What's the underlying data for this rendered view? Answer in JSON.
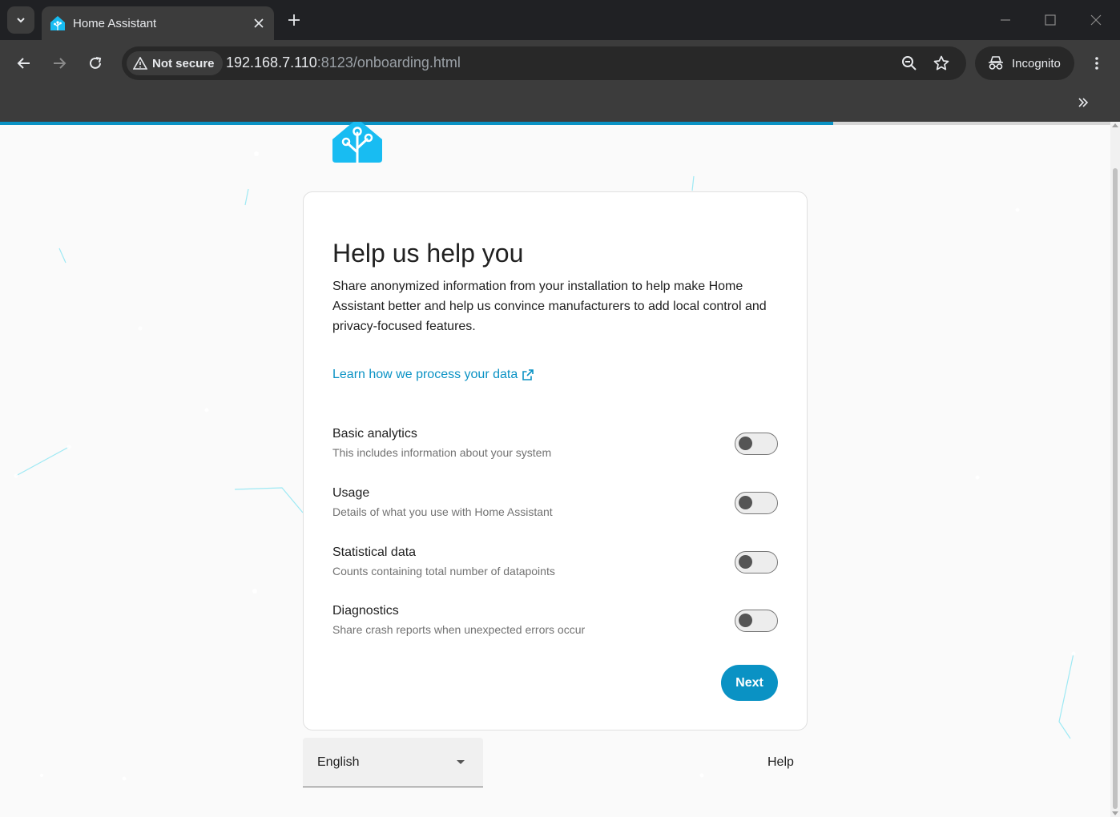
{
  "browser": {
    "tab_title": "Home Assistant",
    "security_label": "Not secure",
    "url_host": "192.168.7.110",
    "url_rest": ":8123/onboarding.html",
    "incognito_label": "Incognito",
    "icons": {
      "tab_search": "chevron-down-icon",
      "tab_close": "close-icon",
      "new_tab": "plus-icon",
      "back": "arrow-left-icon",
      "forward": "arrow-right-icon",
      "reload": "reload-icon",
      "security": "warning-icon",
      "zoom": "zoom-icon",
      "bookmark": "star-icon",
      "incognito": "incognito-icon",
      "menu": "kebab-menu-icon",
      "overflow": "double-chevron-icon"
    }
  },
  "page": {
    "progress_fraction": 0.75,
    "accent_color": "#0a92c4",
    "card": {
      "title": "Help us help you",
      "description": "Share anonymized information from your installation to help make Home Assistant better and help us convince manufacturers to add local control and privacy-focused features.",
      "learn_link": "Learn how we process your data",
      "options": [
        {
          "label": "Basic analytics",
          "description": "This includes information about your system",
          "enabled": false
        },
        {
          "label": "Usage",
          "description": "Details of what you use with Home Assistant",
          "enabled": false
        },
        {
          "label": "Statistical data",
          "description": "Counts containing total number of datapoints",
          "enabled": false
        },
        {
          "label": "Diagnostics",
          "description": "Share crash reports when unexpected errors occur",
          "enabled": false
        }
      ],
      "next_label": "Next"
    },
    "footer": {
      "language": "English",
      "help_label": "Help"
    }
  }
}
